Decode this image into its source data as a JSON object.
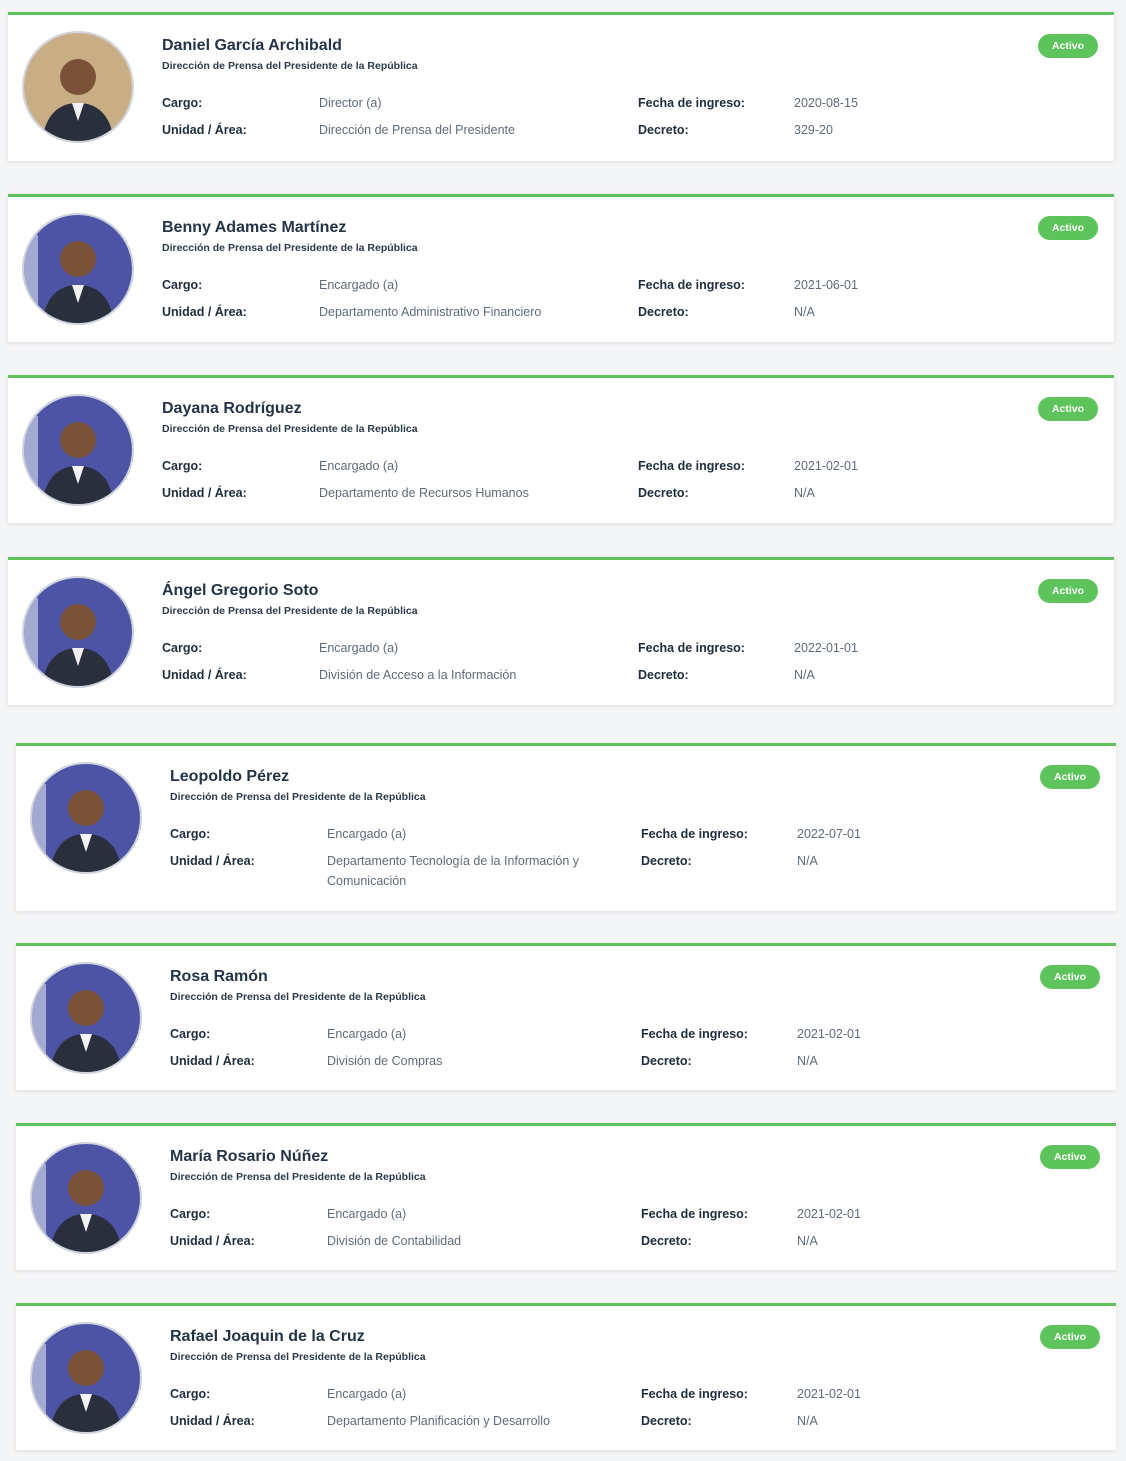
{
  "labels": {
    "cargo": "Cargo:",
    "unidad": "Unidad / Área:",
    "fecha": "Fecha de ingreso:",
    "decreto": "Decreto:"
  },
  "employees": [
    {
      "name": "Daniel García Archibald",
      "org": "Dirección de Prensa del Presidente de la República",
      "status": "Activo",
      "cargo": "Director (a)",
      "unidad": "Dirección de Prensa del Presidente",
      "fecha": "2020-08-15",
      "decreto": "329-20"
    },
    {
      "name": "Benny Adames Martínez",
      "org": "Dirección de Prensa del Presidente de la República",
      "status": "Activo",
      "cargo": "Encargado (a)",
      "unidad": "Departamento Administrativo Financiero",
      "fecha": "2021-06-01",
      "decreto": "N/A"
    },
    {
      "name": "Dayana Rodríguez",
      "org": "Dirección de Prensa del Presidente de la República",
      "status": "Activo",
      "cargo": "Encargado (a)",
      "unidad": "Departamento de Recursos Humanos",
      "fecha": "2021-02-01",
      "decreto": "N/A"
    },
    {
      "name": "Ángel Gregorio Soto",
      "org": "Dirección de Prensa del Presidente de la República",
      "status": "Activo",
      "cargo": "Encargado (a)",
      "unidad": "División de Acceso a la Información",
      "fecha": "2022-01-01",
      "decreto": "N/A"
    },
    {
      "name": "Leopoldo Pérez",
      "org": "Dirección de Prensa del Presidente de la República",
      "status": "Activo",
      "cargo": "Encargado (a)",
      "unidad": "Departamento Tecnología de la Información y Comunicación",
      "fecha": "2022-07-01",
      "decreto": "N/A"
    },
    {
      "name": "Rosa Ramón",
      "org": "Dirección de Prensa del Presidente de la República",
      "status": "Activo",
      "cargo": "Encargado (a)",
      "unidad": "División de Compras",
      "fecha": "2021-02-01",
      "decreto": "N/A"
    },
    {
      "name": "María Rosario Núñez",
      "org": "Dirección de Prensa del Presidente de la República",
      "status": "Activo",
      "cargo": "Encargado (a)",
      "unidad": "División de Contabilidad",
      "fecha": "2021-02-01",
      "decreto": "N/A"
    },
    {
      "name": "Rafael Joaquin de la Cruz",
      "org": "Dirección de Prensa del Presidente de la República",
      "status": "Activo",
      "cargo": "Encargado (a)",
      "unidad": "Departamento Planificación y Desarrollo",
      "fecha": "2021-02-01",
      "decreto": "N/A"
    }
  ],
  "colors": {
    "accent": "#5cc45a",
    "photo_bg": "#4a4f9c"
  }
}
